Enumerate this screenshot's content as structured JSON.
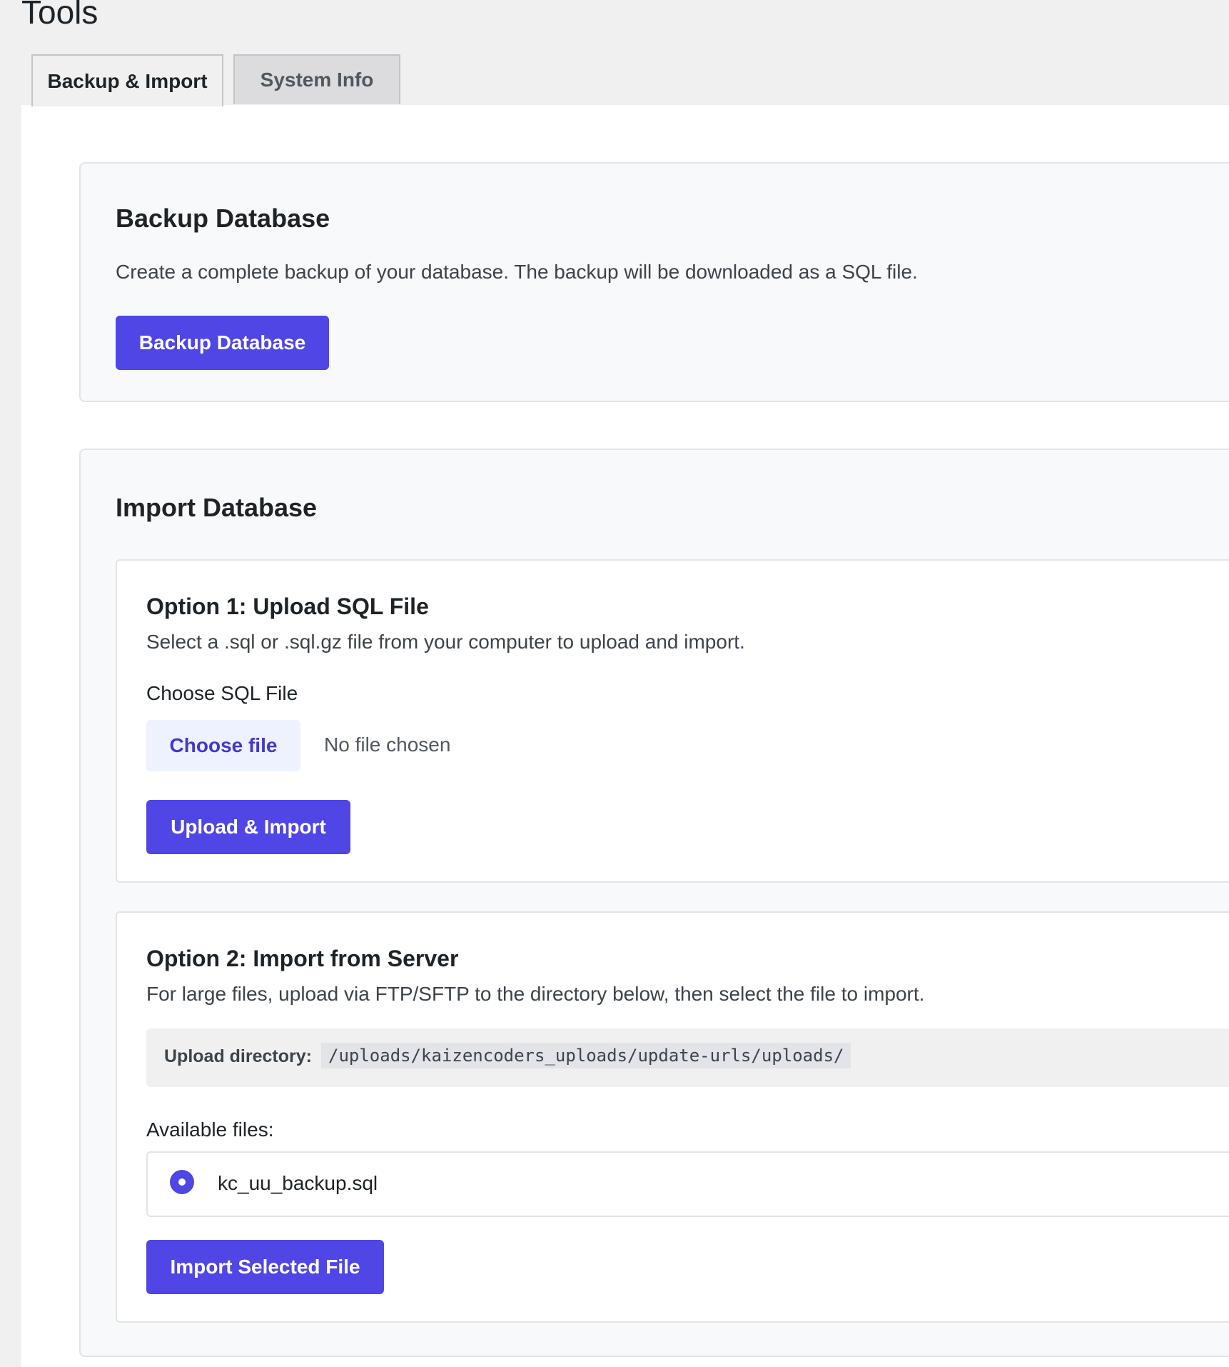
{
  "page": {
    "title": "Tools"
  },
  "tabs": [
    {
      "label": "Backup & Import",
      "active": true
    },
    {
      "label": "System Info",
      "active": false
    }
  ],
  "backup": {
    "heading": "Backup Database",
    "description": "Create a complete backup of your database. The backup will be downloaded as a SQL file.",
    "button_label": "Backup Database"
  },
  "import": {
    "heading": "Import Database",
    "option1": {
      "heading": "Option 1: Upload SQL File",
      "description": "Select a .sql or .sql.gz file from your computer to upload and import.",
      "field_label": "Choose SQL File",
      "file_button_label": "Choose file",
      "file_status": "No file chosen",
      "button_label": "Upload & Import"
    },
    "option2": {
      "heading": "Option 2: Import from Server",
      "description": "For large files, upload via FTP/SFTP to the directory below, then select the file to import.",
      "directory_label": "Upload directory:",
      "directory_path": "/uploads/kaizencoders_uploads/update-urls/uploads/",
      "files_label": "Available files:",
      "files": [
        {
          "name": "kc_uu_backup.sql",
          "selected": true
        }
      ],
      "button_label": "Import Selected File"
    }
  },
  "colors": {
    "accent": "#4f46e5",
    "accent_light": "#eef2ff",
    "page_bg": "#f0f0f1",
    "card_bg": "#f8f9fa"
  }
}
